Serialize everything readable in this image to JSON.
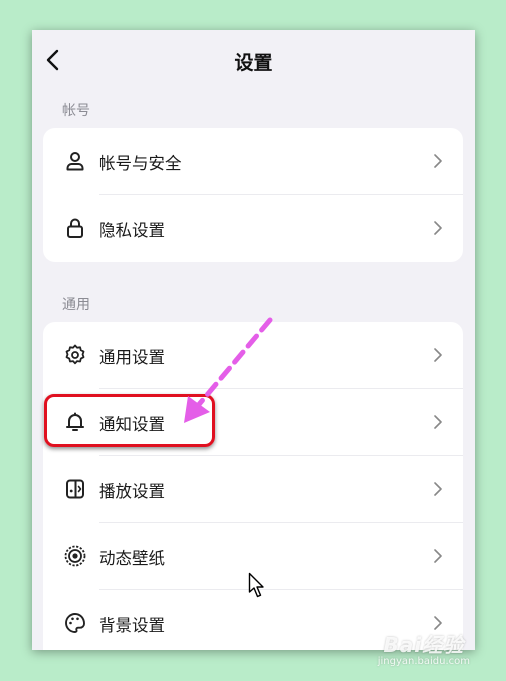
{
  "header": {
    "title": "设置"
  },
  "sections": [
    {
      "label": "帐号",
      "items": [
        {
          "label": "帐号与安全",
          "icon": "user-icon"
        },
        {
          "label": "隐私设置",
          "icon": "lock-icon"
        }
      ]
    },
    {
      "label": "通用",
      "items": [
        {
          "label": "通用设置",
          "icon": "gear-icon"
        },
        {
          "label": "通知设置",
          "icon": "bell-icon"
        },
        {
          "label": "播放设置",
          "icon": "play-settings-icon"
        },
        {
          "label": "动态壁纸",
          "icon": "live-wallpaper-icon"
        },
        {
          "label": "背景设置",
          "icon": "palette-icon"
        }
      ]
    }
  ],
  "annotation": {
    "color": "#e01020",
    "arrow_color": "#e45ee8"
  },
  "watermark": {
    "main": "Bai经验",
    "sub": "jingyan.baidu.com"
  }
}
